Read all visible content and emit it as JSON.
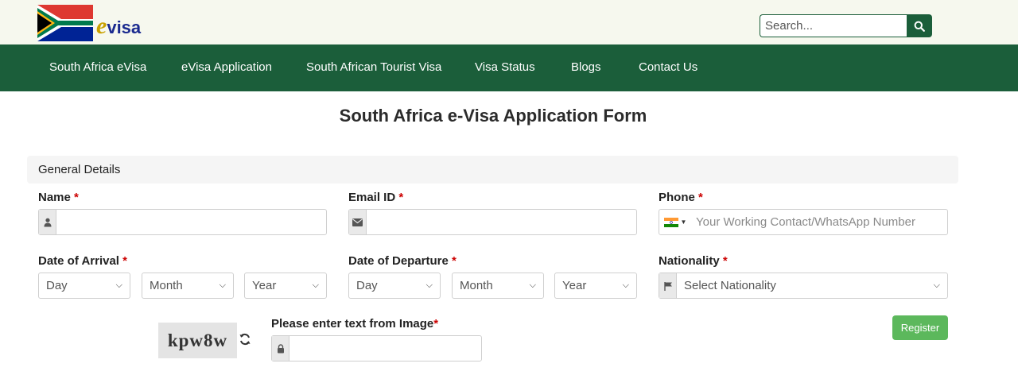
{
  "header": {
    "logo_text": "visa",
    "logo_e": "e",
    "search": {
      "placeholder": "Search..."
    }
  },
  "nav": {
    "items": [
      {
        "label": "South Africa eVisa"
      },
      {
        "label": "eVisa Application"
      },
      {
        "label": "South African Tourist Visa"
      },
      {
        "label": "Visa Status"
      },
      {
        "label": "Blogs"
      },
      {
        "label": "Contact Us"
      }
    ]
  },
  "form": {
    "title": "South Africa e-Visa Application Form",
    "section": "General Details",
    "required_mark": "*",
    "name": {
      "label": "Name",
      "value": ""
    },
    "email": {
      "label": "Email ID",
      "value": ""
    },
    "phone": {
      "label": "Phone",
      "placeholder": "Your Working Contact/WhatsApp Number",
      "country": "India"
    },
    "arrival": {
      "label": "Date of Arrival",
      "day": "Day",
      "month": "Month",
      "year": "Year"
    },
    "departure": {
      "label": "Date of Departure",
      "day": "Day",
      "month": "Month",
      "year": "Year"
    },
    "nationality": {
      "label": "Nationality",
      "selected": "Select Nationality"
    },
    "captcha": {
      "image_text": "kpw8w",
      "label": "Please enter text from Image",
      "value": ""
    },
    "register_label": "Register"
  },
  "colors": {
    "brand_green": "#1b5e3a",
    "button_green": "#5cb85c",
    "required": "#cc0000"
  }
}
